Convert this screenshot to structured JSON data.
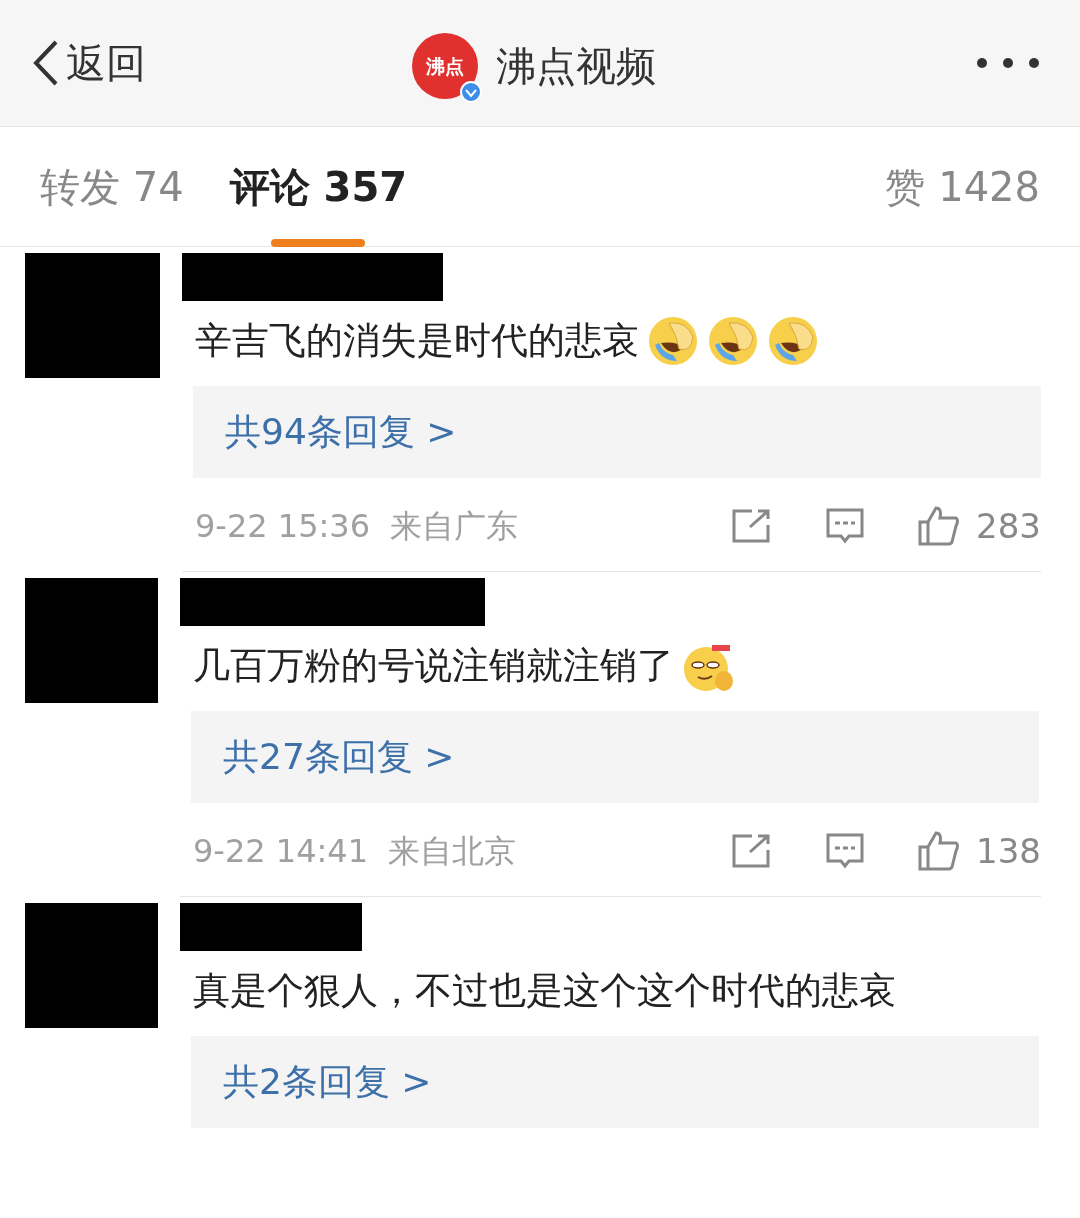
{
  "header": {
    "back_label": "返回",
    "logo_text": "沸点",
    "account_name": "沸点视频",
    "verified": true
  },
  "tabs": [
    {
      "label": "转发 74",
      "selected": false
    },
    {
      "label": "评论 357",
      "selected": true
    }
  ],
  "likes_label": "赞 1428",
  "comments": [
    {
      "text": "辛吉飞的消失是时代的悲哀",
      "emoji": [
        {
          "kind": "laugh-cry"
        },
        {
          "kind": "laugh-cry"
        },
        {
          "kind": "laugh-cry"
        }
      ],
      "replies": "共94条回复 >",
      "meta": "9-22 15:36  来自广东",
      "likes": "283"
    },
    {
      "text": "几百万粉的号说注销就注销了",
      "emoji": [
        {
          "kind": "smirk-thumb"
        }
      ],
      "replies": "共27条回复 >",
      "meta": "9-22 14:41  来自北京",
      "likes": "138"
    },
    {
      "text": "真是个狠人，不过也是这个这个时代的悲哀",
      "replies": "共2条回复 >"
    }
  ]
}
